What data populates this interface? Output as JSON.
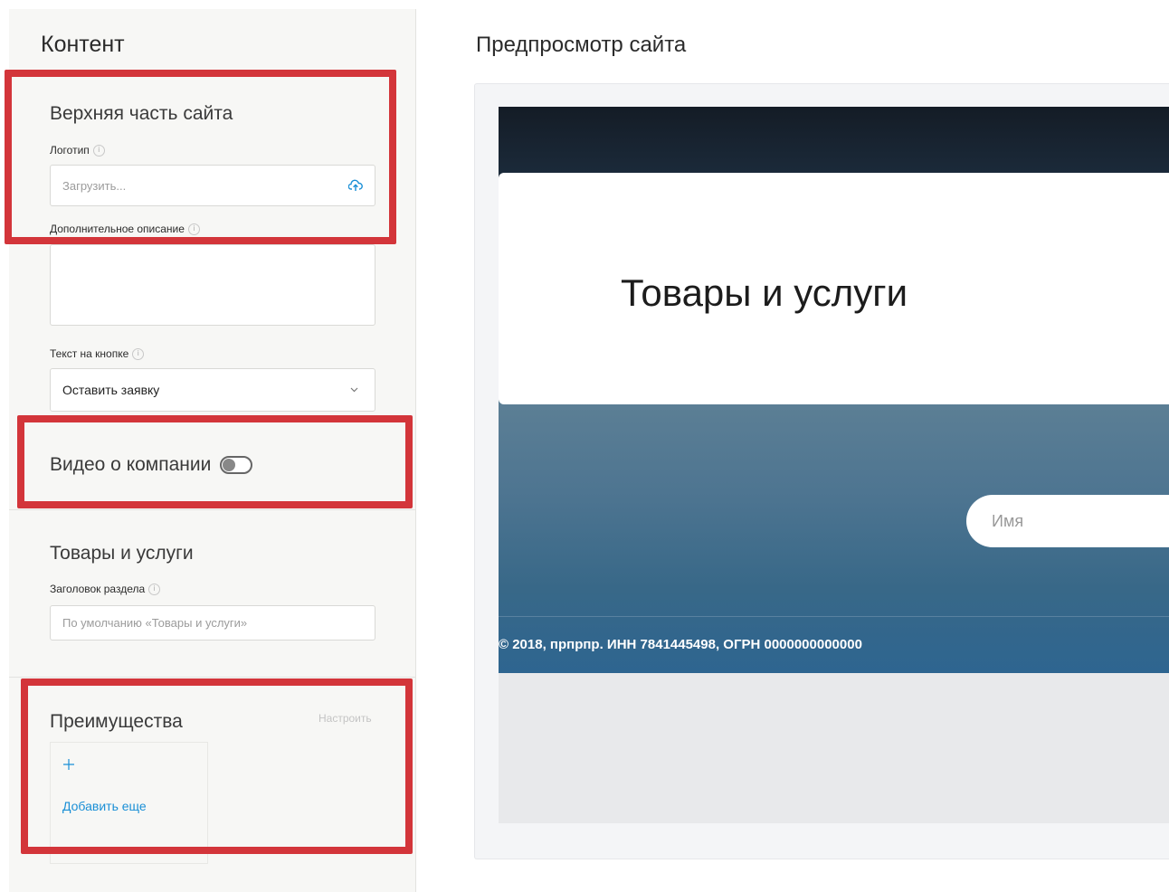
{
  "sidebar": {
    "title": "Контент",
    "header_section": {
      "title": "Верхняя часть сайта",
      "logo_label": "Логотип",
      "logo_placeholder": "Загрузить...",
      "description_label": "Дополнительное описание",
      "button_text_label": "Текст на кнопке",
      "button_text_value": "Оставить заявку"
    },
    "video_section": {
      "title": "Видео о компании",
      "enabled": false
    },
    "products_section": {
      "title": "Товары и услуги",
      "heading_label": "Заголовок раздела",
      "heading_placeholder": "По умолчанию «Товары и услуги»"
    },
    "advantages_section": {
      "title": "Преимущества",
      "configure_label": "Настроить",
      "add_more_label": "Добавить еще"
    }
  },
  "preview": {
    "title": "Предпросмотр сайта",
    "site_heading": "Товары и услуги",
    "name_placeholder": "Имя",
    "footer_text": "© 2018, прпрпр. ИНН 7841445498, ОГРН 0000000000000"
  },
  "icons": {
    "info": "info-icon",
    "upload": "cloud-upload-icon",
    "chevron": "chevron-down-icon",
    "plus": "plus-icon"
  },
  "colors": {
    "accent": "#1a8fd6",
    "highlight": "#d3353a"
  }
}
